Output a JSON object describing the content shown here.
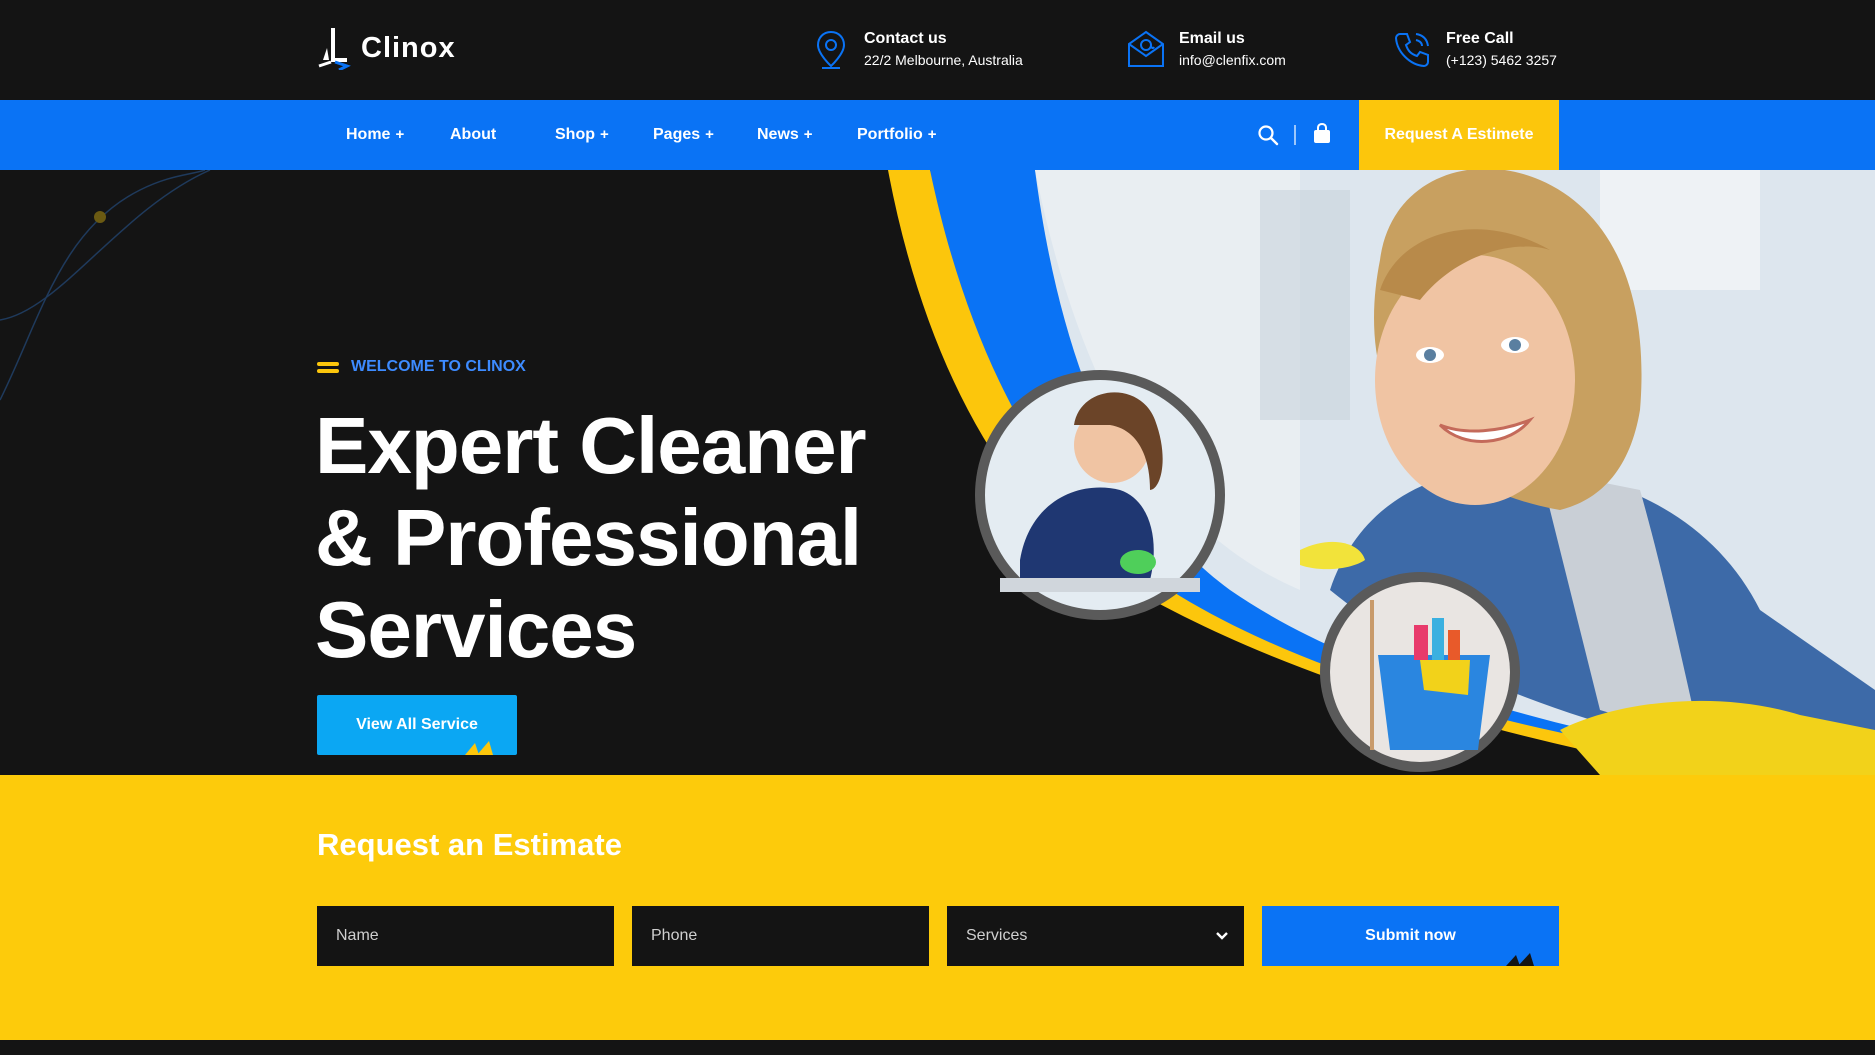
{
  "brand": {
    "name": "Clinox"
  },
  "contacts": [
    {
      "title": "Contact us",
      "value": "22/2 Melbourne, Australia",
      "icon": "location-pin-icon"
    },
    {
      "title": "Email us",
      "value": "info@clenfix.com",
      "icon": "email-icon"
    },
    {
      "title": "Free Call",
      "value": "(+123) 5462 3257",
      "icon": "phone-icon"
    }
  ],
  "nav": {
    "items": [
      {
        "label": "Home",
        "has_submenu": true
      },
      {
        "label": "About",
        "has_submenu": false
      },
      {
        "label": "Shop",
        "has_submenu": true
      },
      {
        "label": "Pages",
        "has_submenu": true
      },
      {
        "label": "News",
        "has_submenu": true
      },
      {
        "label": "Portfolio",
        "has_submenu": true
      }
    ],
    "submenu_symbol": "+",
    "cta_label": "Request A Estimete"
  },
  "hero": {
    "tagline": "WELCOME TO CLINOX",
    "headline_lines": [
      "Expert Cleaner",
      "& Professional",
      "Services"
    ],
    "button_label": "View All Service"
  },
  "estimate": {
    "title": "Request an Estimate",
    "name_placeholder": "Name",
    "phone_placeholder": "Phone",
    "services_selected": "Services",
    "submit_label": "Submit now"
  },
  "colors": {
    "dark": "#141414",
    "blue": "#0a73f5",
    "yellow": "#fcc60c",
    "light_blue": "#0ba7f3"
  }
}
